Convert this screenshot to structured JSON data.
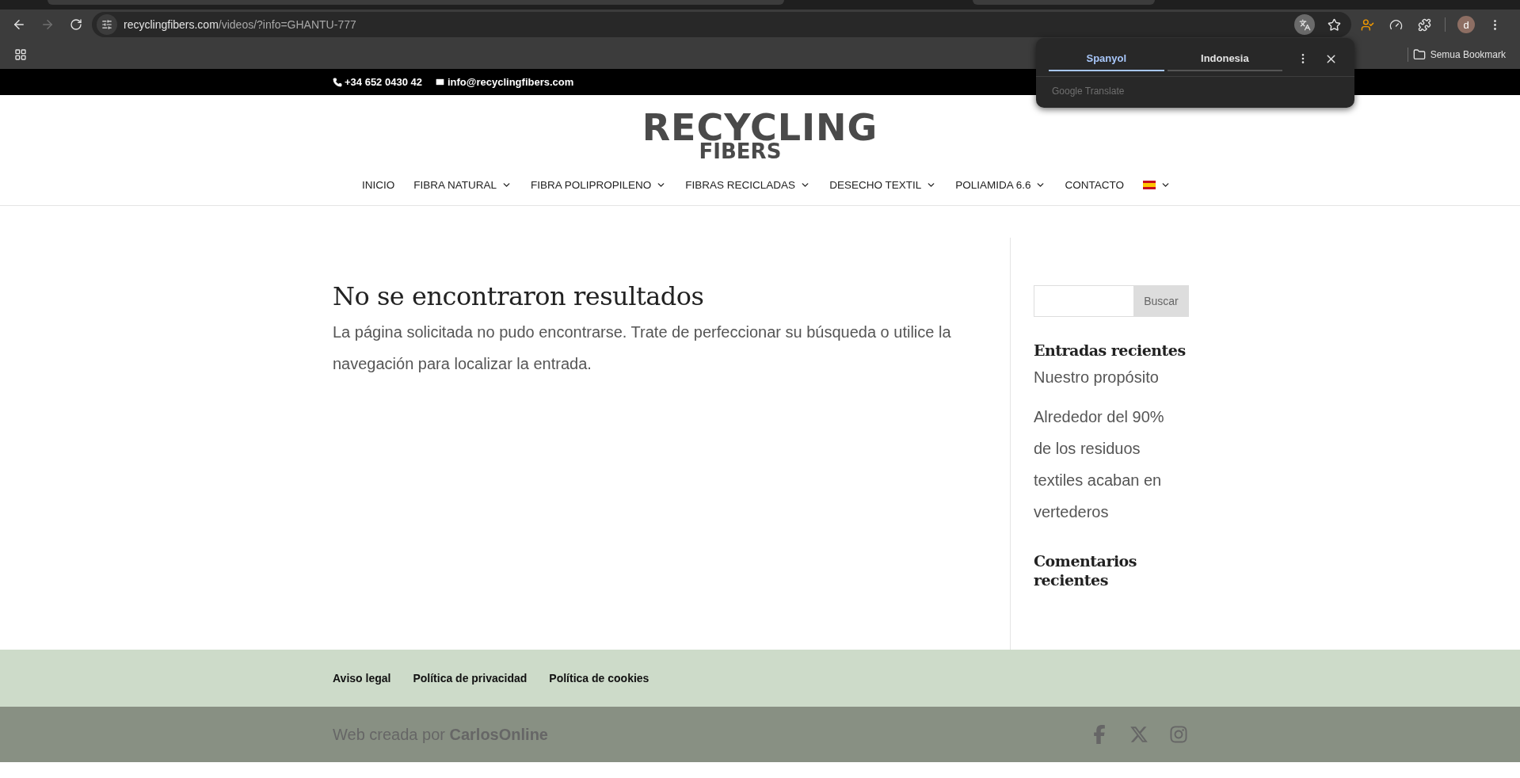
{
  "browser": {
    "back": {
      "disabled": false
    },
    "forward": {
      "disabled": true
    },
    "url": {
      "host": "recyclingfibers.com",
      "path": "/videos/?info=GHANTU-777"
    },
    "avatar": "d",
    "bookmarks_folder": "Semua Bookmark"
  },
  "translate_popup": {
    "tabs": [
      {
        "label": "Spanyol",
        "selected": true
      },
      {
        "label": "Indonesia",
        "selected": false
      }
    ],
    "footer": "Google Translate"
  },
  "top_bar": {
    "phone": "+34 652 0430 42",
    "email": "info@recyclingfibers.com"
  },
  "logo": {
    "line1": "RECYCLING",
    "line2": "FIBERS"
  },
  "nav": [
    {
      "kind": "text",
      "label": "INICIO",
      "has_dropdown": false
    },
    {
      "kind": "text",
      "label": "FIBRA NATURAL",
      "has_dropdown": true
    },
    {
      "kind": "text",
      "label": "FIBRA POLIPROPILENO",
      "has_dropdown": true
    },
    {
      "kind": "text",
      "label": "FIBRAS RECICLADAS",
      "has_dropdown": true
    },
    {
      "kind": "text",
      "label": "DESECHO TEXTIL",
      "has_dropdown": true
    },
    {
      "kind": "text",
      "label": "POLIAMIDA 6.6",
      "has_dropdown": true
    },
    {
      "kind": "text",
      "label": "CONTACTO",
      "has_dropdown": false
    },
    {
      "kind": "flag",
      "has_dropdown": true
    }
  ],
  "main": {
    "title": "No se encontraron resultados",
    "text": "La página solicitada no pudo encontrarse. Trate de perfeccionar su búsqueda o utilice la navegación para localizar la entrada."
  },
  "sidebar": {
    "search_button": "Buscar",
    "recent_posts_title": "Entradas recientes",
    "recent_posts": [
      "Nuestro propósito",
      "Alrededor del 90% de los residuos textiles acaban en vertederos"
    ],
    "recent_comments_title": "Comentarios recientes"
  },
  "footer": {
    "links": [
      "Aviso legal",
      "Política de privacidad",
      "Política de cookies"
    ],
    "credit": "Web creada por **CarlosOnline**",
    "social": [
      {
        "kind": "facebook"
      },
      {
        "kind": "x"
      },
      {
        "kind": "instagram"
      }
    ]
  }
}
